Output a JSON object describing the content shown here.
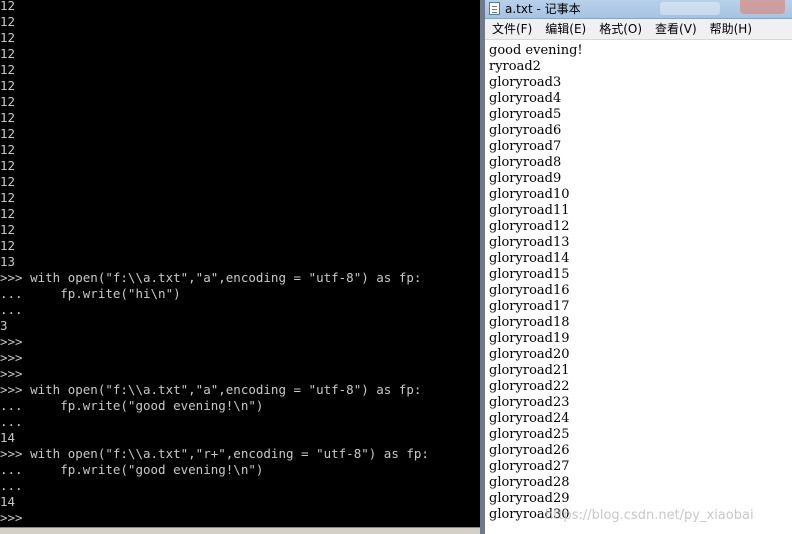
{
  "console": {
    "lines": [
      "12",
      "12",
      "12",
      "12",
      "12",
      "12",
      "12",
      "12",
      "12",
      "12",
      "12",
      "12",
      "12",
      "12",
      "12",
      "12",
      "13",
      ">>> with open(\"f:\\\\a.txt\",\"a\",encoding = \"utf-8\") as fp:",
      "...     fp.write(\"hi\\n\")",
      "...",
      "3",
      ">>>",
      ">>>",
      ">>>",
      ">>> with open(\"f:\\\\a.txt\",\"a\",encoding = \"utf-8\") as fp:",
      "...     fp.write(\"good evening!\\n\")",
      "...",
      "14",
      ">>> with open(\"f:\\\\a.txt\",\"r+\",encoding = \"utf-8\") as fp:",
      "...     fp.write(\"good evening!\\n\")",
      "...",
      "14",
      ">>>"
    ]
  },
  "notepad": {
    "title": "a.txt - 记事本",
    "menu": [
      "文件(F)",
      "编辑(E)",
      "格式(O)",
      "查看(V)",
      "帮助(H)"
    ],
    "lines": [
      "good evening!",
      "ryroad2",
      "gloryroad3",
      "gloryroad4",
      "gloryroad5",
      "gloryroad6",
      "gloryroad7",
      "gloryroad8",
      "gloryroad9",
      "gloryroad10",
      "gloryroad11",
      "gloryroad12",
      "gloryroad13",
      "gloryroad14",
      "gloryroad15",
      "gloryroad16",
      "gloryroad17",
      "gloryroad18",
      "gloryroad19",
      "gloryroad20",
      "gloryroad21",
      "gloryroad22",
      "gloryroad23",
      "gloryroad24",
      "gloryroad25",
      "gloryroad26",
      "gloryroad27",
      "gloryroad28",
      "gloryroad29",
      "gloryroad30"
    ]
  },
  "watermark": "https://blog.csdn.net/py_xiaobai"
}
